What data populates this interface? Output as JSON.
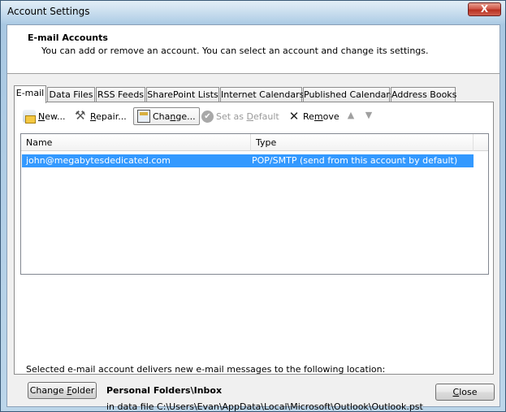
{
  "window": {
    "title": "Account Settings",
    "close_glyph": "X"
  },
  "header": {
    "title": "E-mail Accounts",
    "description": "You can add or remove an account. You can select an account and change its settings."
  },
  "tabs": [
    {
      "label": "E-mail",
      "active": true
    },
    {
      "label": "Data Files",
      "active": false
    },
    {
      "label": "RSS Feeds",
      "active": false
    },
    {
      "label": "SharePoint Lists",
      "active": false
    },
    {
      "label": "Internet Calendars",
      "active": false
    },
    {
      "label": "Published Calendars",
      "active": false
    },
    {
      "label": "Address Books",
      "active": false
    }
  ],
  "toolbar": {
    "new": {
      "pre": "",
      "accel": "N",
      "post": "ew...",
      "icon": "new-account-icon"
    },
    "repair": {
      "pre": "",
      "accel": "R",
      "post": "epair...",
      "icon": "repair-tools-icon"
    },
    "change": {
      "pre": "Cha",
      "accel": "n",
      "post": "ge...",
      "icon": "change-settings-icon"
    },
    "set_default": {
      "pre": "Set as ",
      "accel": "D",
      "post": "efault",
      "icon": "checkmark-circle-icon",
      "disabled": true
    },
    "remove": {
      "pre": "Re",
      "accel": "m",
      "post": "ove",
      "icon": "x-remove-icon"
    },
    "move_up": {
      "glyph": "🡅",
      "icon": "arrow-up-icon"
    },
    "move_down": {
      "glyph": "🡇",
      "icon": "arrow-down-icon"
    }
  },
  "accounts_list": {
    "columns": [
      "Name",
      "Type"
    ],
    "rows": [
      {
        "name": "john@megabytesdedicated.com",
        "type": "POP/SMTP (send from this account by default)",
        "selected": true
      }
    ]
  },
  "delivery": {
    "label": "Selected e-mail account delivers new e-mail messages to the following location:",
    "change_folder": {
      "pre": "Change ",
      "accel": "F",
      "post": "older"
    },
    "folder_name": "Personal Folders\\Inbox",
    "folder_path": "in data file C:\\Users\\Evan\\AppData\\Local\\Microsoft\\Outlook\\Outlook.pst"
  },
  "footer": {
    "close": {
      "pre": "",
      "accel": "C",
      "post": "lose"
    }
  }
}
